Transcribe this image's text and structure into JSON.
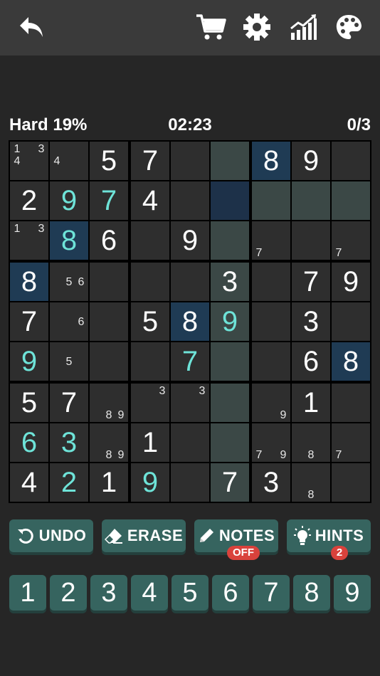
{
  "toolbar": {
    "icons": [
      "back-arrow-icon",
      "shopping-cart-icon",
      "gear-icon",
      "stats-chart-icon",
      "palette-icon"
    ]
  },
  "status": {
    "difficulty": "Hard 19%",
    "timer": "02:23",
    "mistakes": "0/3"
  },
  "board": {
    "cells": [
      [
        {
          "n": "1 3 4"
        },
        {
          "n": "4"
        },
        {
          "v": "5"
        },
        {
          "v": "7"
        },
        {},
        {},
        {
          "v": "8",
          "sel": true
        },
        {
          "v": "9"
        },
        {}
      ],
      [
        {
          "v": "2"
        },
        {
          "u": "9"
        },
        {
          "u": "7"
        },
        {
          "v": "4"
        },
        {},
        {
          "selrow": true
        },
        {},
        {},
        {}
      ],
      [
        {
          "n": "1 3"
        },
        {
          "u": "8",
          "sel": true
        },
        {
          "v": "6"
        },
        {},
        {
          "v": "9"
        },
        {},
        {
          "n": "7"
        },
        {},
        {
          "n": "7"
        }
      ],
      [
        {
          "v": "8",
          "sel": true
        },
        {
          "n": "5 6"
        },
        {},
        {},
        {},
        {
          "v": "3"
        },
        {},
        {
          "v": "7"
        },
        {
          "v": "9"
        }
      ],
      [
        {
          "v": "7"
        },
        {
          "n": "6"
        },
        {},
        {
          "v": "5"
        },
        {
          "v": "8",
          "sel": true
        },
        {
          "u": "9"
        },
        {},
        {
          "v": "3"
        },
        {}
      ],
      [
        {
          "u": "9"
        },
        {
          "n": "5"
        },
        {},
        {},
        {
          "u": "7"
        },
        {},
        {},
        {
          "v": "6"
        },
        {
          "v": "8",
          "sel": true
        }
      ],
      [
        {
          "v": "5"
        },
        {
          "v": "7"
        },
        {
          "n": "8 9"
        },
        {
          "n": "3"
        },
        {
          "n": "3"
        },
        {},
        {
          "n": "9"
        },
        {
          "v": "1"
        },
        {}
      ],
      [
        {
          "u": "6"
        },
        {
          "u": "3"
        },
        {
          "n": "8 9"
        },
        {
          "v": "1"
        },
        {},
        {},
        {
          "n": "7 9"
        },
        {
          "n": "8"
        },
        {
          "n": "7"
        }
      ],
      [
        {
          "v": "4"
        },
        {
          "u": "2"
        },
        {
          "v": "1"
        },
        {
          "u": "9"
        },
        {},
        {
          "v": "7"
        },
        {
          "v": "3"
        },
        {
          "n": "8"
        },
        {}
      ]
    ],
    "highlighted_column": 5,
    "highlighted_row": 1
  },
  "actions": {
    "undo": "UNDO",
    "erase": "ERASE",
    "notes": "NOTES",
    "notes_state": "OFF",
    "hints": "HINTS",
    "hints_count": "2"
  },
  "keypad": [
    "1",
    "2",
    "3",
    "4",
    "5",
    "6",
    "7",
    "8",
    "9"
  ],
  "colors": {
    "accent": "#36645f",
    "user_digit": "#6ee3d8",
    "selected_cell": "#1f3b54",
    "badge": "#d9423c"
  }
}
